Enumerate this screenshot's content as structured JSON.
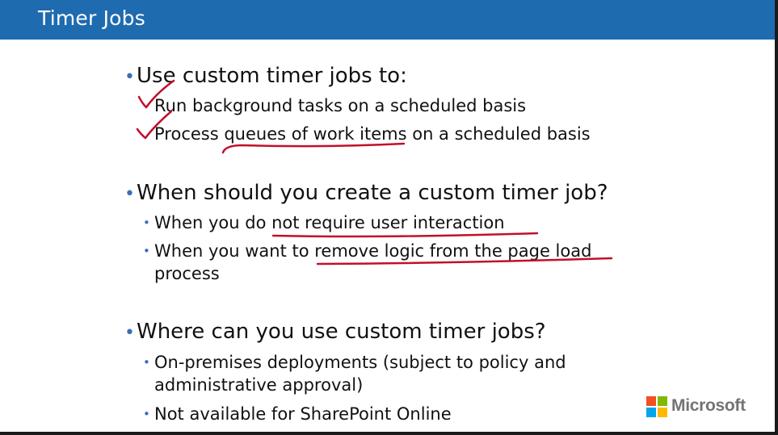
{
  "slide": {
    "title": "Timer Jobs",
    "sections": [
      {
        "heading": "Use custom timer jobs to:",
        "items": [
          "Run background tasks on a scheduled basis",
          "Process queues of work items on a scheduled basis"
        ]
      },
      {
        "heading": "When should you create a custom timer job?",
        "items": [
          "When you do not require user interaction",
          "When you want to remove logic from the page load",
          "process"
        ]
      },
      {
        "heading": "Where can you use custom timer jobs?",
        "items": [
          "On-premises deployments (subject to policy and",
          "administrative approval)",
          "Not available for SharePoint Online"
        ]
      }
    ],
    "bullet_glyph": "•",
    "logo_text": "Microsoft"
  },
  "colors": {
    "title_bar": "#1e6bb0",
    "ink_annotation": "#c0102a",
    "bullet": "#3a6fb5"
  }
}
